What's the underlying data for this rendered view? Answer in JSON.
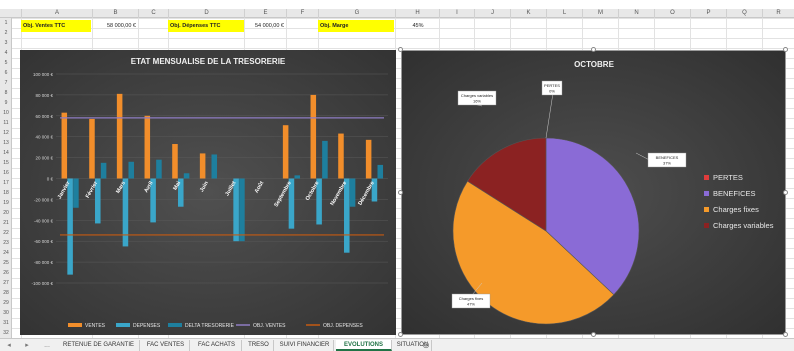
{
  "columns": [
    "A",
    "B",
    "C",
    "D",
    "E",
    "F",
    "G",
    "H",
    "I",
    "J",
    "K",
    "L",
    "M",
    "N",
    "O",
    "P",
    "Q",
    "R"
  ],
  "rows": [
    "1",
    "2",
    "3",
    "4",
    "5",
    "6",
    "7",
    "8",
    "9",
    "10",
    "11",
    "12",
    "13",
    "14",
    "15",
    "16",
    "17",
    "18",
    "19",
    "20",
    "21",
    "22",
    "23",
    "24",
    "25",
    "26",
    "27",
    "28",
    "29",
    "30",
    "31",
    "32"
  ],
  "cells": {
    "a1": "Obj. Ventes TTC",
    "b1": "58 000,00 €",
    "d1": "Obj. Dépenses TTC",
    "e1": "54 000,00 €",
    "g1": "Obj. Marge",
    "h1": "45%"
  },
  "chart_data": [
    {
      "type": "bar",
      "title": "ETAT MENSUALISE DE LA TRESORERIE",
      "categories": [
        "Janvier",
        "Février",
        "Mars",
        "Avril",
        "Mai",
        "Juin",
        "Juillet",
        "Août",
        "Septembre",
        "Octobre",
        "Novembre",
        "Décembre"
      ],
      "ylim": [
        -100000,
        100000
      ],
      "yticks": [
        "100 000 €",
        "80 000 €",
        "60 000 €",
        "40 000 €",
        "20 000 €",
        "0 €",
        "-20 000 €",
        "-40 000 €",
        "-60 000 €",
        "-80 000 €",
        "-100 000 €"
      ],
      "series": [
        {
          "name": "VENTES",
          "color": "#f28e2b",
          "values": [
            63000,
            57000,
            81000,
            60000,
            33000,
            24000,
            0,
            0,
            51000,
            80000,
            43000,
            37000
          ]
        },
        {
          "name": "DEPENSES",
          "color": "#3aa6c9",
          "values": [
            -92000,
            -43000,
            -65000,
            -42000,
            -27000,
            0,
            -60000,
            0,
            -48000,
            -44000,
            -71000,
            -22000
          ]
        },
        {
          "name": "DELTA TRESORERIE",
          "color": "#1e7f9e",
          "values": [
            -28000,
            15000,
            16000,
            18000,
            5000,
            23000,
            -60000,
            0,
            3000,
            36000,
            -27000,
            13000
          ]
        }
      ],
      "lines": [
        {
          "name": "OBJ. VENTES",
          "color": "#8e7cc3",
          "value": 58000
        },
        {
          "name": "OBJ. DEPENSES",
          "color": "#c55a11",
          "value": -54000
        }
      ]
    },
    {
      "type": "pie",
      "title": "OCTOBRE",
      "slices": [
        {
          "name": "PERTES",
          "label": "PERTES",
          "percent_label": "0%",
          "value": 0,
          "color": "#e03c3c"
        },
        {
          "name": "BENEFICES",
          "label": "BENEFICES",
          "percent_label": "37%",
          "value": 37,
          "color": "#8a6bd6"
        },
        {
          "name": "Charges fixes",
          "label": "Charges fixes",
          "percent_label": "47%",
          "value": 47,
          "color": "#f59a2a"
        },
        {
          "name": "Charges variables",
          "label": "Charges variables",
          "percent_label": "16%",
          "value": 16,
          "color": "#8b2222"
        }
      ]
    }
  ],
  "tabs": [
    "RETENUE DE GARANTIE",
    "FAC VENTES",
    "FAC ACHATS",
    "TRESO",
    "SUIVI FINANCIER",
    "EVOLUTIONS",
    "SITUATION"
  ],
  "active_tab": "EVOLUTIONS",
  "nav": {
    "prev": "◂",
    "next": "▸",
    "more": "...",
    "add": "⊕"
  }
}
